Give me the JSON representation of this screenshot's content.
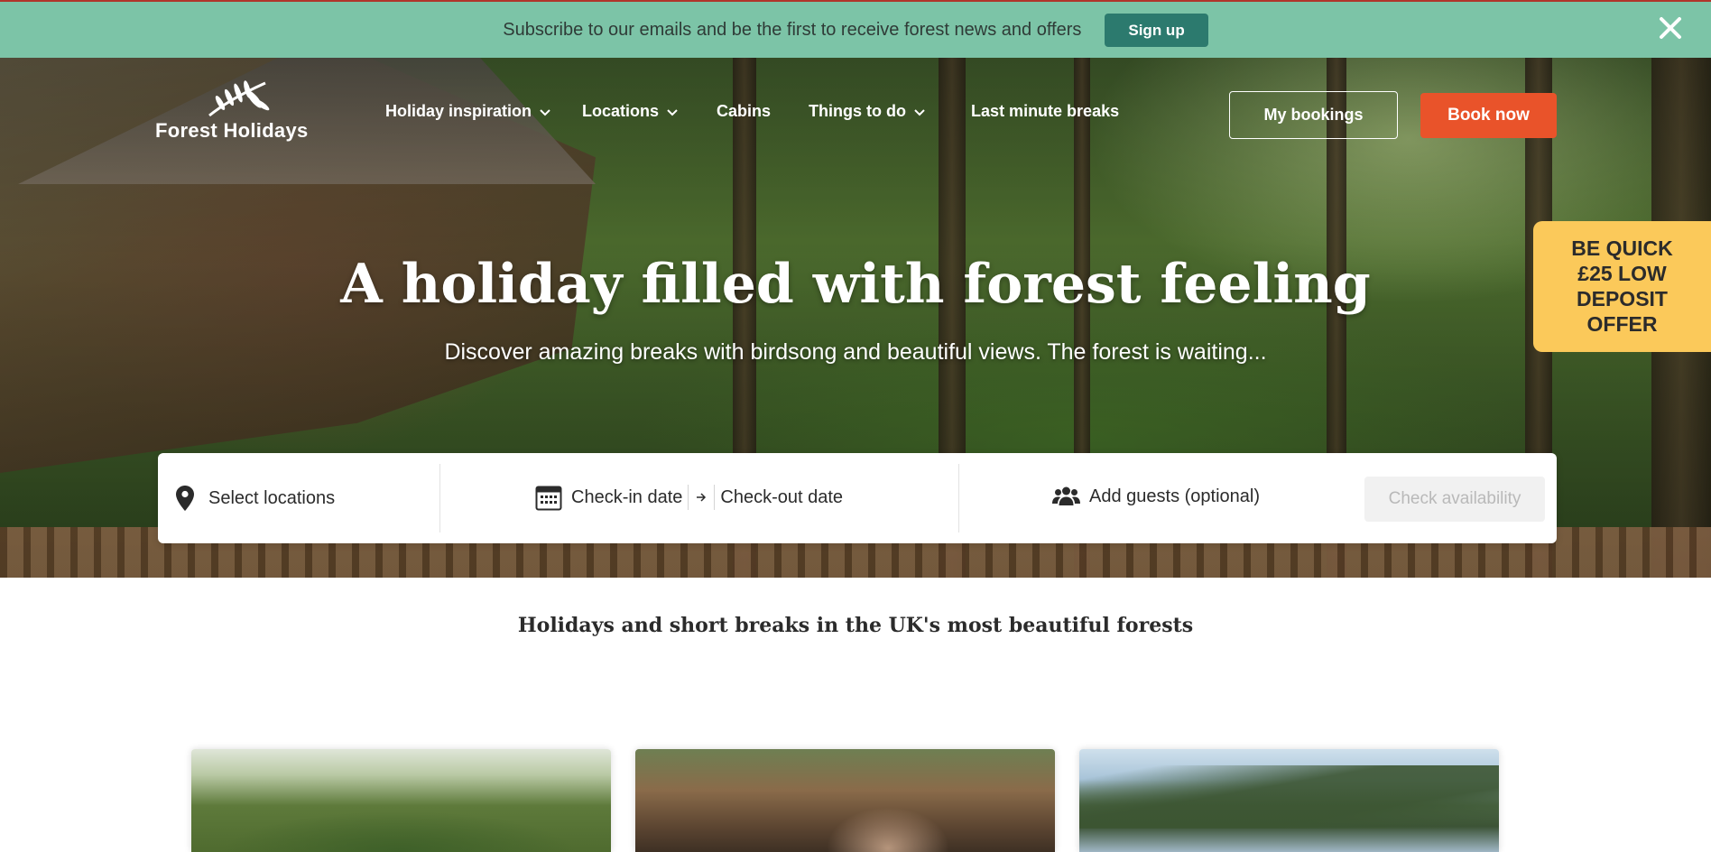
{
  "banner": {
    "text": "Subscribe to our emails and be the first to receive forest news and offers",
    "signup_label": "Sign up",
    "close_icon": "close-icon"
  },
  "header": {
    "logo_text": "Forest Holidays",
    "logo_icon": "fern-leaf-logo",
    "nav": [
      {
        "label": "Holiday inspiration",
        "has_dropdown": true
      },
      {
        "label": "Locations",
        "has_dropdown": true
      },
      {
        "label": "Cabins",
        "has_dropdown": false
      },
      {
        "label": "Things to do",
        "has_dropdown": true
      },
      {
        "label": "Last minute breaks",
        "has_dropdown": false
      }
    ],
    "my_bookings_label": "My bookings",
    "book_now_label": "Book now"
  },
  "hero": {
    "title": "A holiday filled with forest feeling",
    "subtitle": "Discover amazing breaks with birdsong and beautiful views. The forest is waiting..."
  },
  "promo": {
    "line1": "BE QUICK",
    "line2": "£25 LOW",
    "line3": "DEPOSIT",
    "line4": "OFFER"
  },
  "search": {
    "location_label": "Select locations",
    "checkin_label": "Check-in date",
    "checkout_label": "Check-out date",
    "guests_label": "Add guests (optional)",
    "check_availability_label": "Check availability",
    "icons": {
      "location": "map-pin-icon",
      "calendar": "calendar-icon",
      "arrow": "arrow-right-icon",
      "guests": "users-icon"
    }
  },
  "main": {
    "tagline": "Holidays and short breaks in the UK's most beautiful forests"
  },
  "colors": {
    "banner_bg": "#7cc4a7",
    "signup_bg": "#2c7a6e",
    "book_now_bg": "#e9532a",
    "promo_bg": "#fbc95a",
    "accent_line": "#b1352b"
  }
}
